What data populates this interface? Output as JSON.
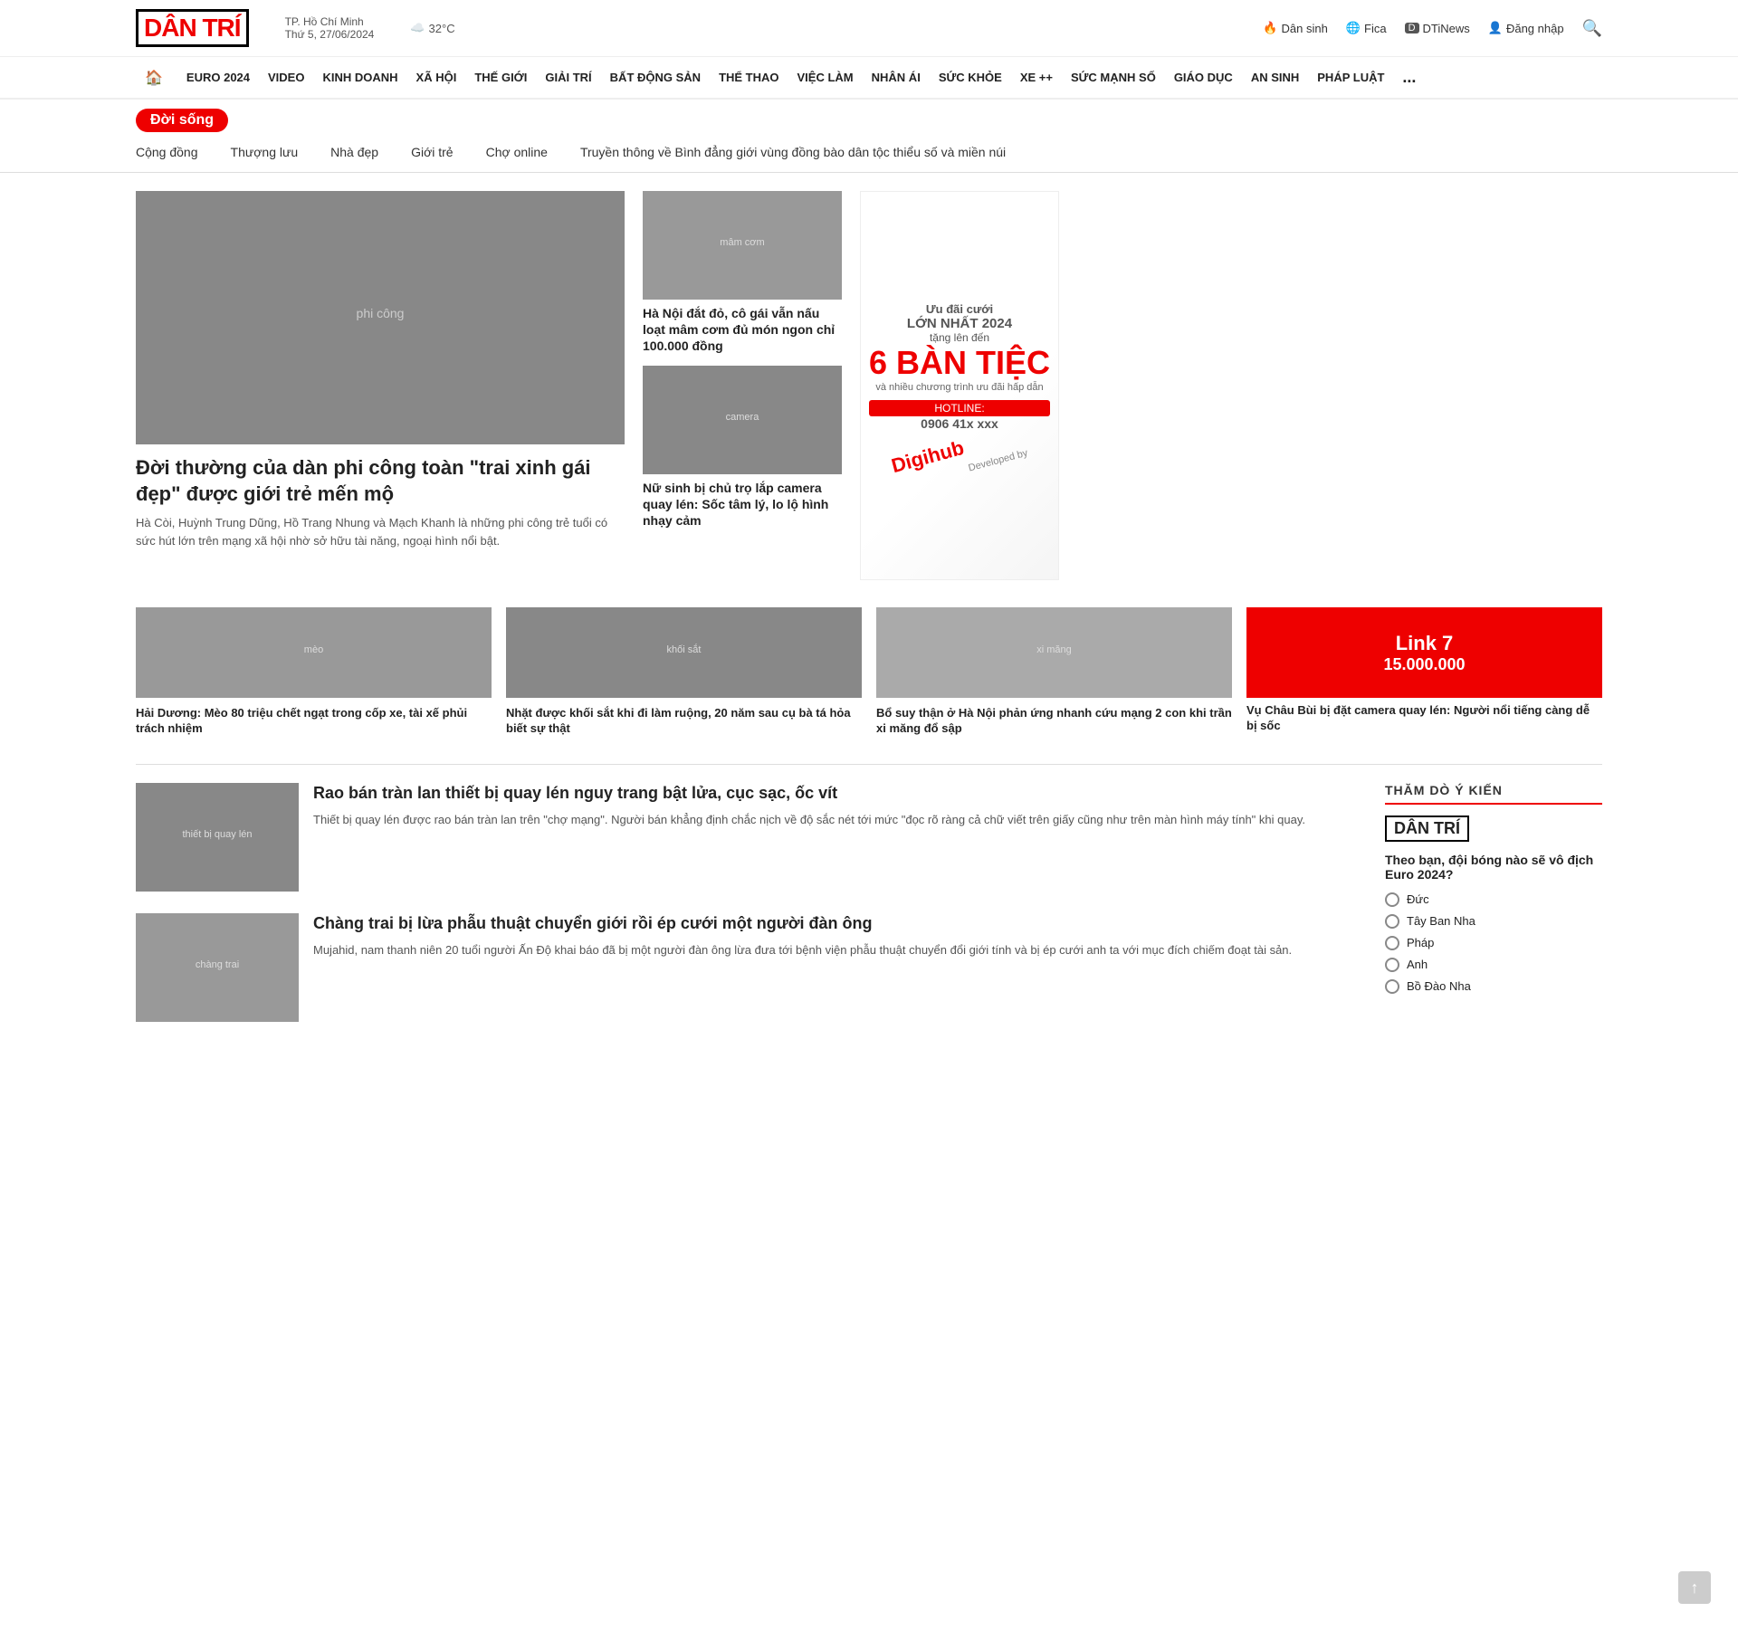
{
  "logo": {
    "text1": "DÂN",
    "text2": "TRÍ"
  },
  "location": {
    "city": "TP. Hồ Chí Minh",
    "date": "Thứ 5, 27/06/2024",
    "weather": "32°C"
  },
  "top_nav": {
    "items": [
      {
        "label": "Dân sinh",
        "icon": "🔥"
      },
      {
        "label": "Fica",
        "icon": "🌐"
      },
      {
        "label": "DTiNews",
        "icon": "🅓"
      }
    ],
    "login": "Đăng nhập",
    "search_icon": "🔍"
  },
  "main_nav": {
    "home_icon": "🏠",
    "items": [
      "EURO 2024",
      "VIDEO",
      "KINH DOANH",
      "XÃ HỘI",
      "THẾ GIỚI",
      "GIẢI TRÍ",
      "BẤT ĐỘNG SẢN",
      "THỂ THAO",
      "VIỆC LÀM",
      "NHÂN ÁI",
      "SỨC KHỎE",
      "XE ++",
      "SỨC MẠNH SỐ",
      "GIÁO DỤC",
      "AN SINH",
      "PHÁP LUẬT",
      "..."
    ]
  },
  "section": {
    "tag": "Đời sống"
  },
  "sub_nav": {
    "items": [
      "Cộng đồng",
      "Thượng lưu",
      "Nhà đẹp",
      "Giới trẻ",
      "Chợ online",
      "Truyền thông về Bình đẳng giới vùng đồng bào dân tộc thiểu số và miền núi"
    ]
  },
  "featured": {
    "title": "Đời thường của dàn phi công toàn \"trai xinh gái đẹp\" được giới trẻ mến mộ",
    "desc": "Hà Còi, Huỳnh Trung Dũng, Hồ Trang Nhung và Mạch Khanh là những phi công trẻ tuổi có sức hút lớn trên mạng xã hội nhờ sở hữu tài năng, ngoại hình nổi bật."
  },
  "center_articles": [
    {
      "title": "Hà Nội đắt đỏ, cô gái vẫn nấu loạt mâm cơm đủ món ngon chỉ 100.000 đồng"
    },
    {
      "title": "Nữ sinh bị chủ trọ lắp camera quay lén: Sốc tâm lý, lo lộ hình nhạy cảm"
    }
  ],
  "ad": {
    "text1": "Ưu đãi cưới",
    "text2": "LỚN NHẤT 2024",
    "text3": "tặng lên đến",
    "big_text": "6 BÀN TIỆC",
    "text4": "và nhiều chương trình ưu đãi hấp dẫn",
    "hotline_label": "HOTLINE:",
    "hotline": "0906 41x xxx",
    "watermark": "Developed by Digihub"
  },
  "bottom_articles": [
    {
      "title": "Hải Dương: Mèo 80 triệu chết ngạt trong cốp xe, tài xế phủi trách nhiệm"
    },
    {
      "title": "Nhặt được khối sắt khi đi làm ruộng, 20 năm sau cụ bà tá hỏa biết sự thật"
    },
    {
      "title": "Bổ suy thận ở Hà Nội phản ứng nhanh cứu mạng 2 con khi trần xi măng đổ sập"
    },
    {
      "red_label": "Link 7",
      "red_number": "15.000.000",
      "title": "Vụ Châu Bùi bị đặt camera quay lén: Người nổi tiếng càng dễ bị sốc"
    }
  ],
  "lower_articles": [
    {
      "title": "Rao bán tràn lan thiết bị quay lén nguy trang bật lửa, cục sạc, ốc vít",
      "desc": "Thiết bị quay lén được rao bán tràn lan trên \"chợ mạng\". Người bán khẳng định chắc nịch về độ sắc nét tới mức \"đọc rõ ràng cả chữ viết trên giấy cũng như trên màn hình máy tính\" khi quay."
    },
    {
      "title": "Chàng trai bị lừa phẫu thuật chuyển giới rồi ép cưới một người đàn ông",
      "desc": "Mujahid, nam thanh niên 20 tuổi người Ấn Độ khai báo đã bị một người đàn ông lừa đưa tới bệnh viện phẫu thuật chuyển đổi giới tính và bị ép cưới anh ta với mục đích chiếm đoạt tài sản."
    }
  ],
  "poll": {
    "title": "THĂM DÒ Ý KIẾN",
    "logo": "DÂN TRÍ",
    "question": "Theo bạn, đội bóng nào sẽ vô địch Euro 2024?",
    "options": [
      "Đức",
      "Tây Ban Nha",
      "Pháp",
      "Anh",
      "Bồ Đào Nha"
    ]
  },
  "scroll_top": "↑"
}
